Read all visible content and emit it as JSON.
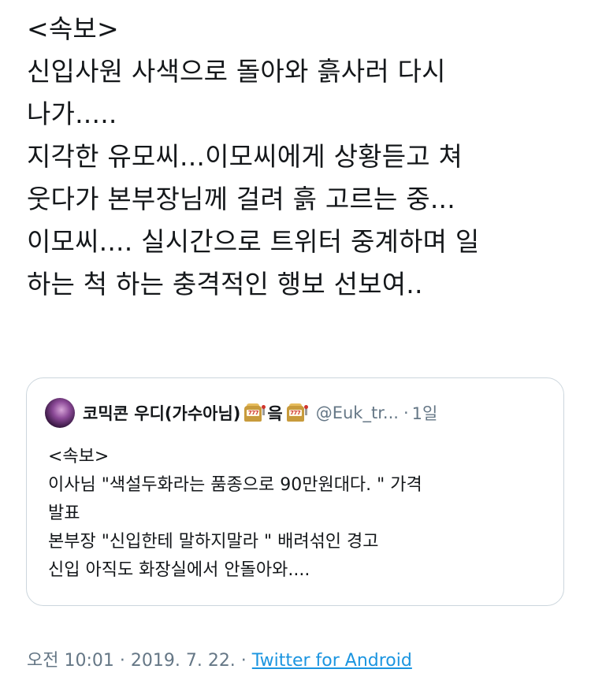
{
  "tweet": {
    "lines": [
      "<속보>",
      "신입사원 사색으로 돌아와 흙사러 다시",
      "나가.....",
      "지각한 유모씨...이모씨에게 상황듣고 쳐",
      "웃다가 본부장님께 걸려 흙 고르는 중...",
      "이모씨.... 실시간으로 트위터 중계하며 일",
      "하는 척 하는 충격적인 행보 선보여.."
    ]
  },
  "quote": {
    "name_part1": "코믹콘 우디(가수아님)",
    "name_part2": "읔",
    "emoji": "slot-machine-icon",
    "handle": "@Euk_tr...",
    "separator": "·",
    "time": "1일",
    "lines": [
      "<속보>",
      "이사님 \"색설두화라는 품종으로 90만원대다. \" 가격",
      "발표",
      "본부장 \"신입한테 말하지말라 \" 배려섞인 경고",
      "신입 아직도 화장실에서 안돌아와...."
    ]
  },
  "meta": {
    "time": "오전 10:01",
    "sep1": " · ",
    "date": "2019. 7. 22.",
    "sep2": " · ",
    "source": "Twitter for Android"
  },
  "colors": {
    "text": "#14171a",
    "secondary": "#657786",
    "link": "#1b95e0",
    "border": "#ccd6dd"
  }
}
